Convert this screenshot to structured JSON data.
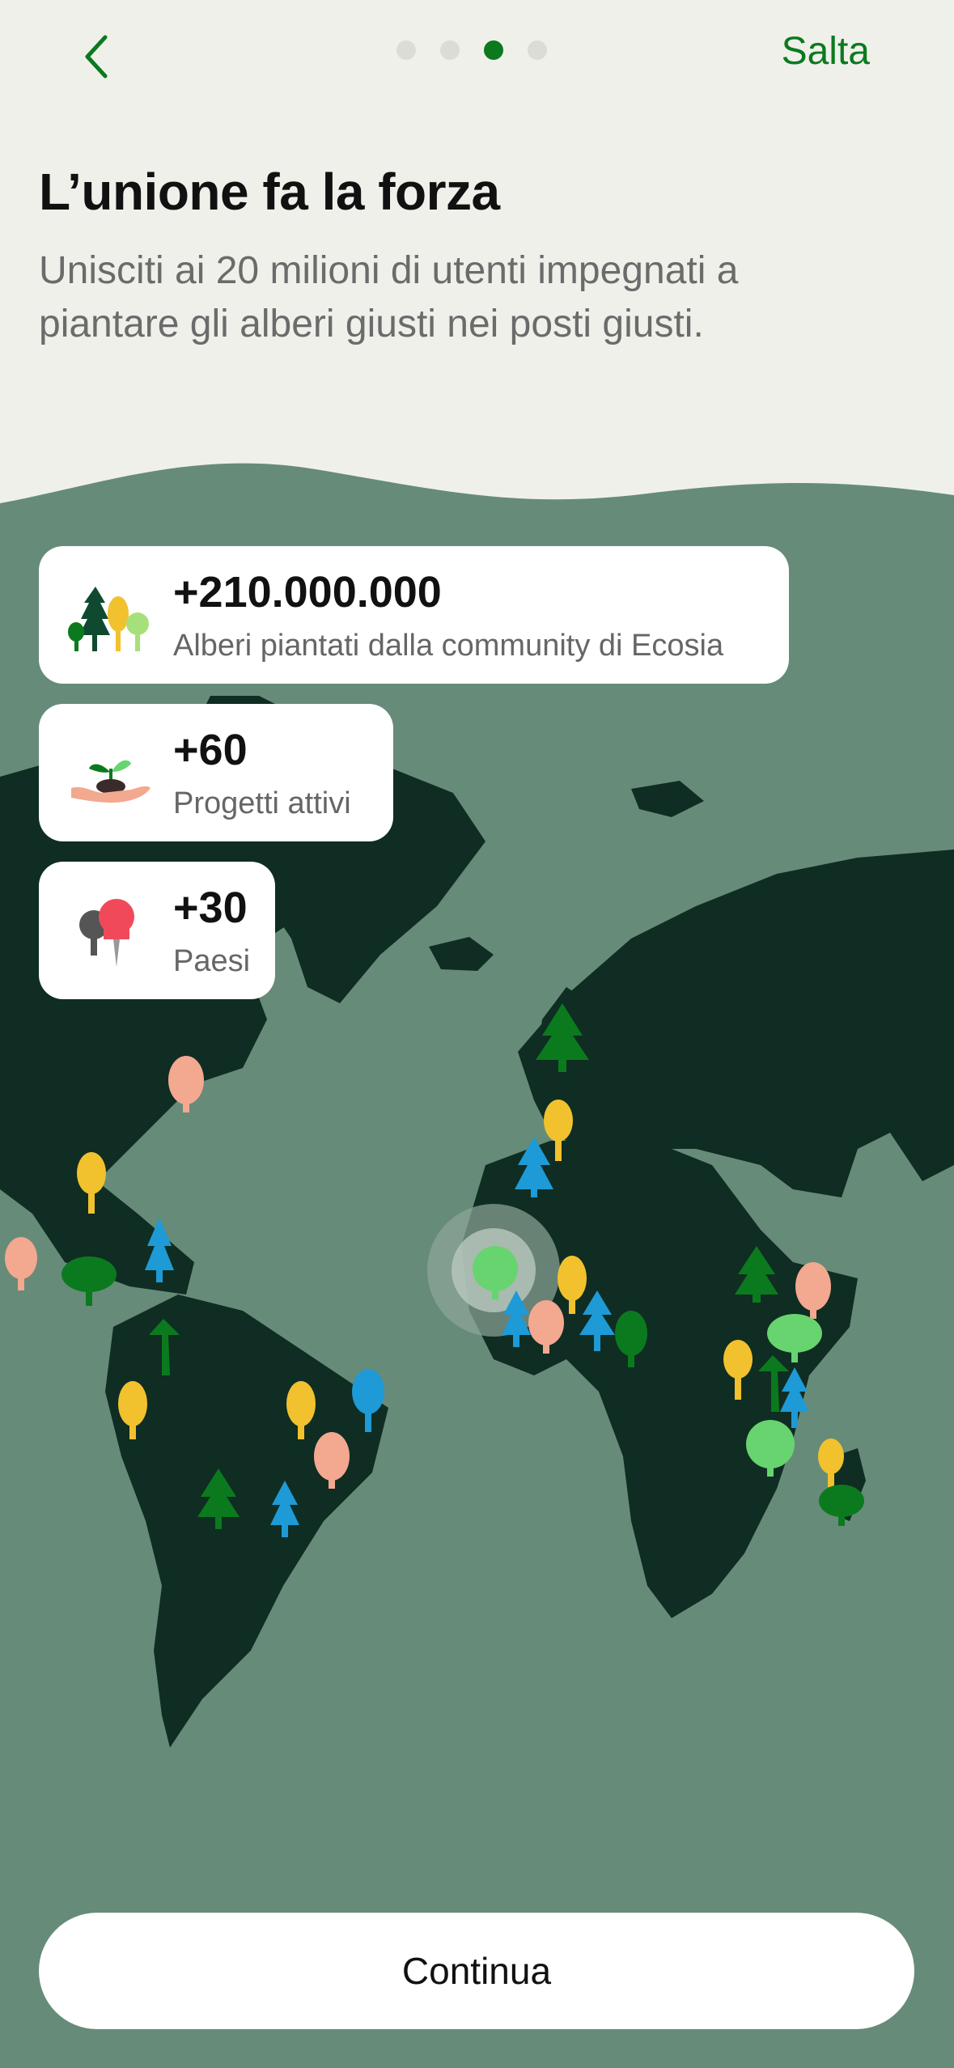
{
  "nav": {
    "skip_label": "Salta",
    "pages": 4,
    "active_page": 3
  },
  "header": {
    "title": "L’unione fa la forza",
    "subtitle": "Unisciti ai 20 milioni di utenti impegnati a piantare gli alberi giusti nei posti giusti."
  },
  "stats": [
    {
      "value": "+210.000.000",
      "label": "Alberi piantati dalla community di Ecosia",
      "icon": "trees-icon"
    },
    {
      "value": "+60",
      "label": "Progetti attivi",
      "icon": "seedling-hand-icon"
    },
    {
      "value": "+30",
      "label": "Paesi",
      "icon": "pushpin-icon"
    }
  ],
  "cta": {
    "label": "Continua"
  },
  "colors": {
    "accent": "#0b7a1e",
    "ocean": "#678b79",
    "land": "#0f2d22",
    "background": "#f0f0eb"
  }
}
